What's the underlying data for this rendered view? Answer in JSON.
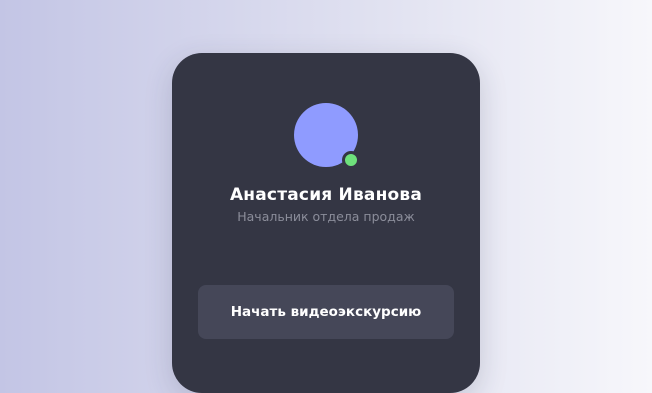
{
  "profile": {
    "name": "Анастасия Иванова",
    "role": "Начальник отдела продаж",
    "status": "online"
  },
  "actions": {
    "start_tour_label": "Начать видеоэкскурсию"
  },
  "colors": {
    "avatar": "#8f9bff",
    "status_online": "#6ee17c",
    "card_background": "#343644",
    "button_background": "#454758",
    "subtitle_text": "#8b8d9a"
  }
}
